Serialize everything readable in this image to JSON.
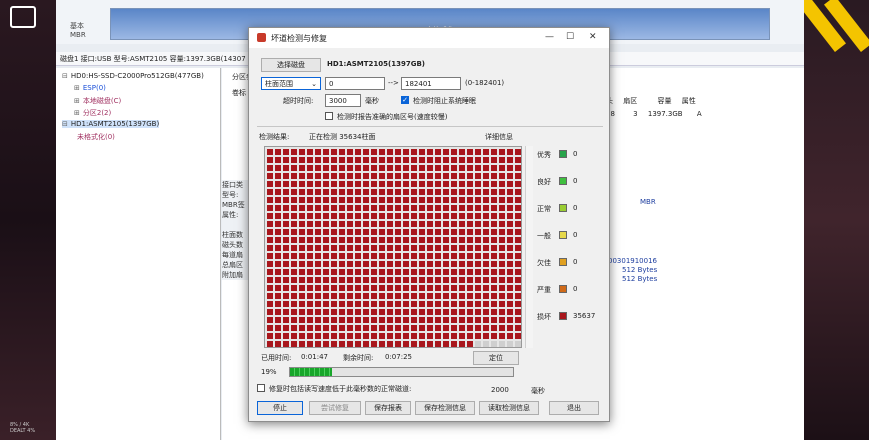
{
  "dialog": {
    "title": "坏道检测与修复",
    "select_disk_label": "选择磁盘",
    "disk_name": "HD1:ASMT2105(1397GB)",
    "range_mode": "柱面范围",
    "range_from": "0",
    "range_arrow": "-->",
    "range_to": "182401",
    "range_hint": "(0-182401)",
    "timeout_label": "超时时间:",
    "timeout_value": "3000",
    "timeout_unit": "毫秒",
    "prevent_sleep_label": "检测时阻止系统睡眠",
    "prevent_sleep_checked": true,
    "report_sector_label": "检测时报告准确的扇区号(速度较慢)",
    "report_sector_checked": false,
    "result_label": "检测结果:",
    "status_text": "正在检测 35634柱面",
    "details_button": "详细信息",
    "legend": [
      {
        "label": "优秀",
        "count": "0",
        "color": "#27a34a"
      },
      {
        "label": "良好",
        "count": "0",
        "color": "#3fbf3f"
      },
      {
        "label": "正常",
        "count": "0",
        "color": "#9acd32"
      },
      {
        "label": "一般",
        "count": "0",
        "color": "#e6d84a"
      },
      {
        "label": "欠佳",
        "count": "0",
        "color": "#e0a020"
      },
      {
        "label": "严重",
        "count": "0",
        "color": "#d06a18"
      },
      {
        "label": "损坏",
        "count": "35637",
        "color": "#a8161c"
      }
    ],
    "elapsed_label": "已用时间:",
    "elapsed_value": "0:01:47",
    "remaining_label": "剩余时间:",
    "remaining_value": "0:07:25",
    "locate_button": "定位",
    "progress_text": "19%",
    "progress_value": 19,
    "repair_read_label": "修复时包括读写速度低于此毫秒数的正常磁道:",
    "repair_read_value": "2000",
    "repair_read_unit": "毫秒",
    "buttons": {
      "stop": "停止",
      "repair": "尝试修复",
      "save_report": "保存报表",
      "save_info": "保存检测信息",
      "load_info": "读取检测信息",
      "exit": "退出"
    }
  },
  "background_app": {
    "disk_type_top": "基本",
    "disk_type_bottom": "MBR",
    "disk_bar_label": "未格式化",
    "disk_info": "磁盘1 接口:USB  型号:ASMT2105  容量:1397.3GB(14307",
    "tree": [
      {
        "text": "HD0:HS-SSD-C2000Pro512GB(477GB)",
        "indent": 0,
        "toggle": "⊟",
        "color": "#222"
      },
      {
        "text": "ESP(0)",
        "indent": 1,
        "toggle": "⊞",
        "color": "#1a4fd8"
      },
      {
        "text": "本地磁盘(C)",
        "indent": 1,
        "toggle": "⊞",
        "color": "#a03060"
      },
      {
        "text": "分区2(2)",
        "indent": 1,
        "toggle": "⊞",
        "color": "#a03060"
      },
      {
        "text": "HD1:ASMT2105(1397GB)",
        "indent": 0,
        "toggle": "⊟",
        "color": "#222"
      },
      {
        "text": "未格式化(0)",
        "indent": 1,
        "toggle": "",
        "color": "#a03060"
      }
    ],
    "pane_labels": [
      "分区参",
      "卷标"
    ],
    "side_labels": [
      "接口类",
      "型号:",
      "MBR签",
      "属性:",
      "柱面数",
      "磁头数",
      "每道扇",
      "总扇区",
      "附加扇"
    ],
    "table_headers": [
      "头",
      "扇区",
      "容量",
      "属性"
    ],
    "table_values": [
      "68",
      "3",
      "1397.3GB",
      "A"
    ],
    "mbr_text": "MBR",
    "serial_text": "00301910016",
    "bytes_1": "512 Bytes",
    "bytes_2": "512 Bytes"
  },
  "overlay": {
    "note": "8% / 4K\nDEALT 4%"
  }
}
